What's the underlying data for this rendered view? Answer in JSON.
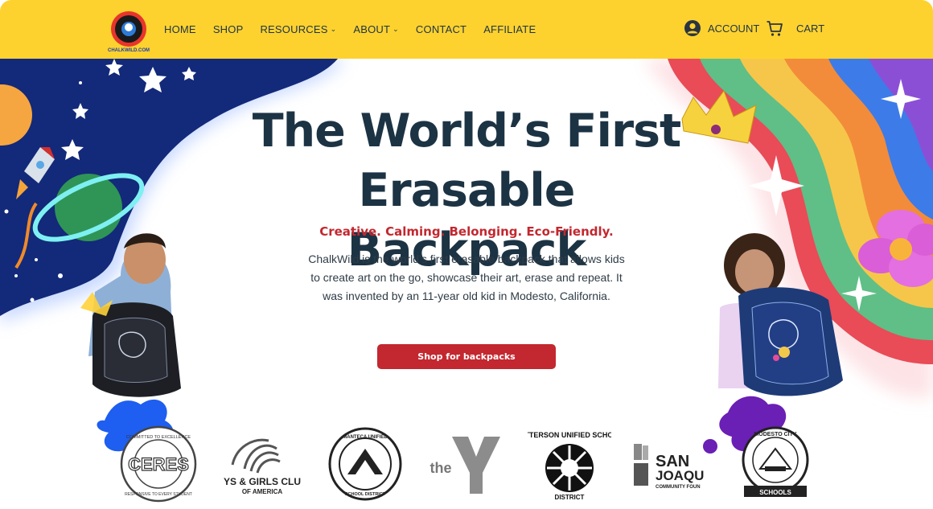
{
  "header": {
    "logo_text": "CHALKWILD.COM",
    "nav": [
      {
        "label": "HOME",
        "has_dropdown": false
      },
      {
        "label": "SHOP",
        "has_dropdown": false
      },
      {
        "label": "RESOURCES",
        "has_dropdown": true
      },
      {
        "label": "ABOUT",
        "has_dropdown": true
      },
      {
        "label": "CONTACT",
        "has_dropdown": false
      },
      {
        "label": "AFFILIATE",
        "has_dropdown": false
      }
    ],
    "account_label": "ACCOUNT",
    "cart_label": "CART",
    "background_color": "#fdd22f"
  },
  "hero": {
    "title_line1": "The World’s First",
    "title_line2": "Erasable Backpack",
    "tagline": "Creative. Calming. Belonging. Eco-Friendly.",
    "description": "ChalkWild is the world’s first erasable backpack that allows kids to create art on the go, showcase their art, erase and repeat. It was invented by an 11-year old kid in Modesto, California.",
    "cta_label": "Shop for backpacks",
    "accent_color": "#c3272f",
    "title_color": "#1c3344"
  },
  "partners": [
    {
      "name": "CERES",
      "line1": "COMMITTED TO EXCELLENCE",
      "line2": "RESPONSIVE TO EVERY STUDENT"
    },
    {
      "name": "YS & GIRLS CLU",
      "line2": "OF AMERICA"
    },
    {
      "name": "MANTECA UNIFIED",
      "line2": "SCHOOL DISTRICT"
    },
    {
      "name": "the",
      "line2": "YMCA"
    },
    {
      "name": "PATTERSON UNIFIED SCHOOL",
      "line2": "DISTRICT"
    },
    {
      "name": "SAN",
      "line1": "JOAQU",
      "line2": "COMMUNITY FOUN"
    },
    {
      "name": "MODESTO CITY",
      "line2": "SCHOOLS"
    }
  ]
}
